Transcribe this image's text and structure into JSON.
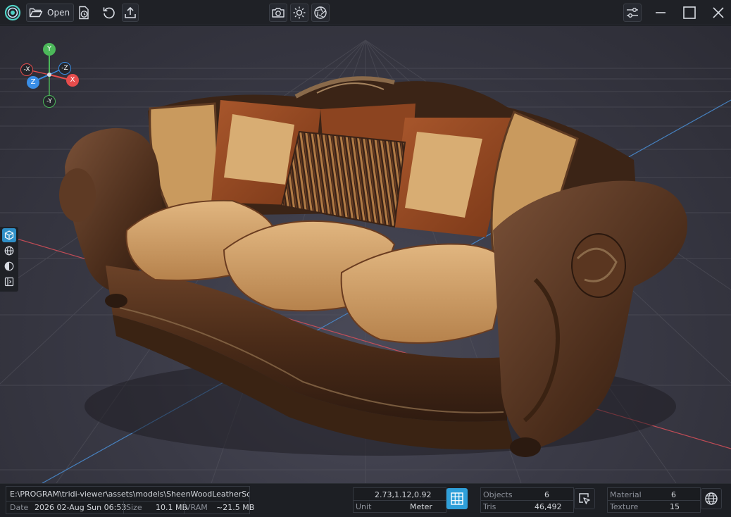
{
  "toolbar": {
    "open_label": "Open"
  },
  "gizmo": {
    "y": "Y",
    "neg_y": "-Y",
    "x": "X",
    "neg_x": "-X",
    "z": "Z",
    "neg_z": "-Z"
  },
  "status": {
    "path": "E:\\PROGRAM\\tridi-viewer\\assets\\models\\SheenWoodLeatherSofa.glb",
    "date_label": "Date",
    "date_value": "2026 02-Aug Sun 06:53",
    "size_label": "Size",
    "size_value": "10.1 MB",
    "vram_label": "VRAM",
    "vram_value": "~21.5 MB",
    "coords": "2.73,1.12,0.92",
    "unit_label": "Unit",
    "unit_value": "Meter",
    "objects_label": "Objects",
    "objects_value": "6",
    "tris_label": "Tris",
    "tris_value": "46,492",
    "material_label": "Material",
    "material_value": "6",
    "texture_label": "Texture",
    "texture_value": "15"
  },
  "colors": {
    "accent": "#2f9fd9",
    "axis_x": "#e64d4d",
    "axis_y": "#4cb85a",
    "axis_z": "#3a8ee6",
    "background": "#1b1d22"
  }
}
